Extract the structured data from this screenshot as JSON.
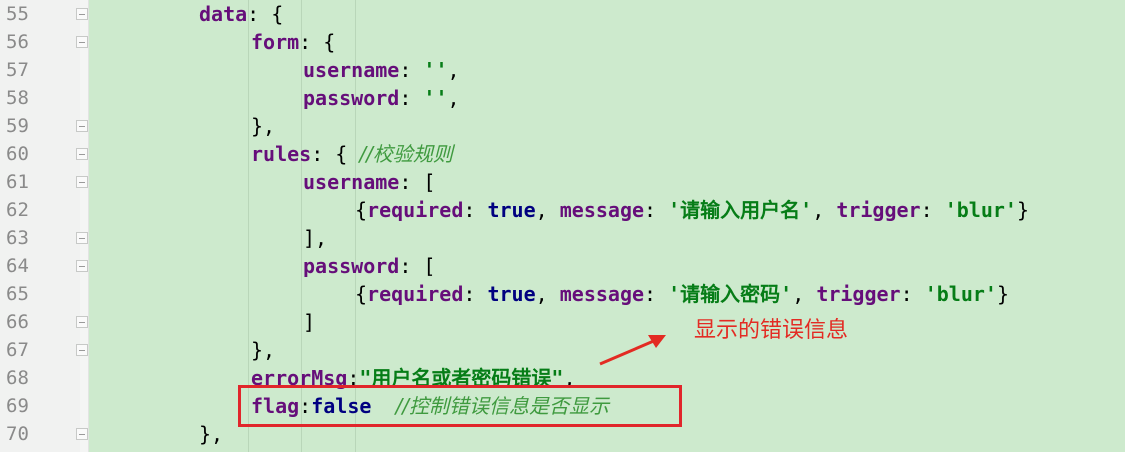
{
  "editor": {
    "lines": [
      {
        "num": "55",
        "parts": [
          {
            "t": "data",
            "c": "k"
          },
          {
            "t": ": {",
            "c": "p"
          }
        ]
      },
      {
        "num": "56",
        "parts": [
          {
            "t": "form",
            "c": "k"
          },
          {
            "t": ": {",
            "c": "p"
          }
        ]
      },
      {
        "num": "57",
        "parts": [
          {
            "t": "username",
            "c": "k"
          },
          {
            "t": ": ",
            "c": "p"
          },
          {
            "t": "''",
            "c": "s"
          },
          {
            "t": ",",
            "c": "p"
          }
        ]
      },
      {
        "num": "58",
        "parts": [
          {
            "t": "password",
            "c": "k"
          },
          {
            "t": ": ",
            "c": "p"
          },
          {
            "t": "''",
            "c": "s"
          },
          {
            "t": ",",
            "c": "p"
          }
        ]
      },
      {
        "num": "59",
        "parts": [
          {
            "t": "},",
            "c": "p"
          }
        ]
      },
      {
        "num": "60",
        "parts": [
          {
            "t": "rules",
            "c": "k"
          },
          {
            "t": ": { ",
            "c": "p"
          },
          {
            "t": "//校验规则",
            "c": "c"
          }
        ]
      },
      {
        "num": "61",
        "parts": [
          {
            "t": "username",
            "c": "k"
          },
          {
            "t": ": [",
            "c": "p"
          }
        ]
      },
      {
        "num": "62",
        "parts": [
          {
            "t": "{",
            "c": "p"
          },
          {
            "t": "required",
            "c": "k"
          },
          {
            "t": ": ",
            "c": "p"
          },
          {
            "t": "true",
            "c": "b"
          },
          {
            "t": ", ",
            "c": "p"
          },
          {
            "t": "message",
            "c": "k"
          },
          {
            "t": ": ",
            "c": "p"
          },
          {
            "t": "'请输入用户名'",
            "c": "s"
          },
          {
            "t": ", ",
            "c": "p"
          },
          {
            "t": "trigger",
            "c": "k"
          },
          {
            "t": ": ",
            "c": "p"
          },
          {
            "t": "'blur'",
            "c": "s"
          },
          {
            "t": "}",
            "c": "p"
          }
        ]
      },
      {
        "num": "63",
        "parts": [
          {
            "t": "],",
            "c": "p"
          }
        ]
      },
      {
        "num": "64",
        "parts": [
          {
            "t": "password",
            "c": "k"
          },
          {
            "t": ": [",
            "c": "p"
          }
        ]
      },
      {
        "num": "65",
        "parts": [
          {
            "t": "{",
            "c": "p"
          },
          {
            "t": "required",
            "c": "k"
          },
          {
            "t": ": ",
            "c": "p"
          },
          {
            "t": "true",
            "c": "b"
          },
          {
            "t": ", ",
            "c": "p"
          },
          {
            "t": "message",
            "c": "k"
          },
          {
            "t": ": ",
            "c": "p"
          },
          {
            "t": "'请输入密码'",
            "c": "s"
          },
          {
            "t": ", ",
            "c": "p"
          },
          {
            "t": "trigger",
            "c": "k"
          },
          {
            "t": ": ",
            "c": "p"
          },
          {
            "t": "'blur'",
            "c": "s"
          },
          {
            "t": "}",
            "c": "p"
          }
        ]
      },
      {
        "num": "66",
        "parts": [
          {
            "t": "]",
            "c": "p"
          }
        ]
      },
      {
        "num": "67",
        "parts": [
          {
            "t": "},",
            "c": "p"
          }
        ]
      },
      {
        "num": "68",
        "parts": [
          {
            "t": "errorMsg",
            "c": "k"
          },
          {
            "t": ":",
            "c": "p"
          },
          {
            "t": "\"用户名或者密码错误\"",
            "c": "s"
          },
          {
            "t": ",",
            "c": "p"
          }
        ]
      },
      {
        "num": "69",
        "parts": [
          {
            "t": "flag",
            "c": "k"
          },
          {
            "t": ":",
            "c": "p"
          },
          {
            "t": "false",
            "c": "b"
          },
          {
            "t": "  ",
            "c": "p"
          },
          {
            "t": "//控制错误信息是否显示",
            "c": "c"
          }
        ]
      },
      {
        "num": "70",
        "parts": [
          {
            "t": "},",
            "c": "p"
          }
        ]
      }
    ]
  },
  "annotation": {
    "note_text": "显示的错误信息",
    "note_color": "#e32b23",
    "box_color": "#e1262b"
  },
  "theme": {
    "background": "#cdeacd",
    "keyword_color": "#660e7a",
    "string_color": "#067d17",
    "boolean_color": "#000080",
    "comment_color": "#3f9a3f"
  }
}
